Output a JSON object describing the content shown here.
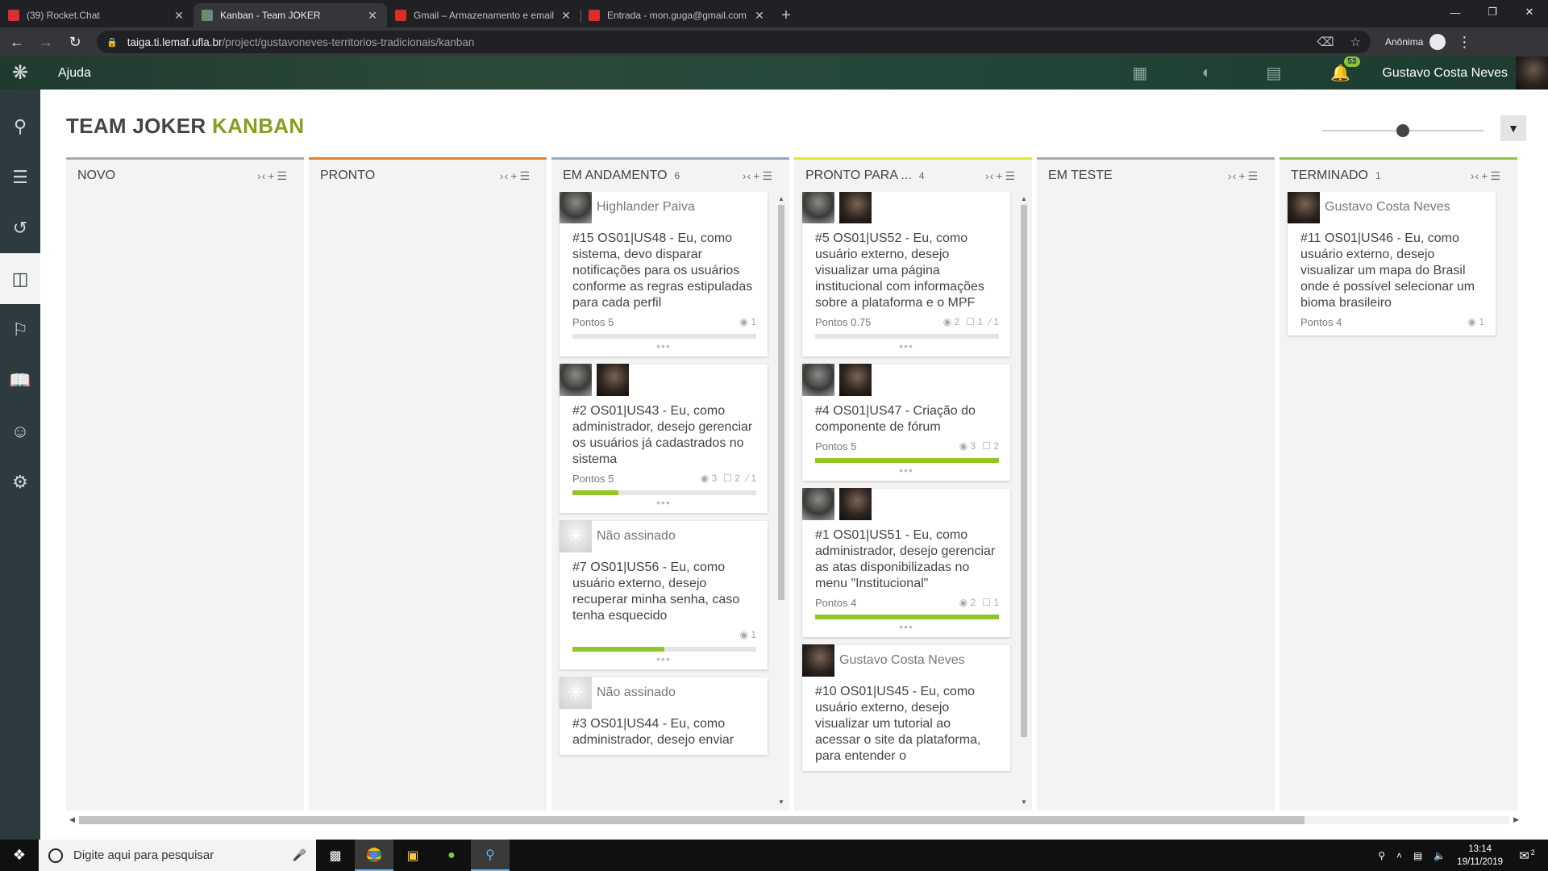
{
  "browser": {
    "tabs": [
      {
        "title": "(39) Rocket.Chat",
        "favicon": "rocket-chat-icon",
        "color": "#d92f2f",
        "active": false
      },
      {
        "title": "Kanban - Team JOKER",
        "favicon": "taiga-icon",
        "color": "#6a8c74",
        "active": true
      },
      {
        "title": "Gmail – Armazenamento e email",
        "favicon": "gmail-icon",
        "color": "#d93025",
        "active": false
      },
      {
        "title": "Entrada - mon.guga@gmail.com",
        "favicon": "gmail-icon",
        "color": "#d93025",
        "active": false
      }
    ],
    "url_host": "taiga.ti.lemaf.ufla.br",
    "url_path": "/project/gustavoneves-territorios-tradicionais/kanban",
    "profile_label": "Anônima"
  },
  "topbar": {
    "help_label": "Ajuda",
    "notifications_count": "53",
    "user_name": "Gustavo Costa Neves"
  },
  "page": {
    "title_main": "TEAM JOKER",
    "title_accent": "KANBAN",
    "accent_color": "#83a01f",
    "zoom_level": 0.5
  },
  "columns": [
    {
      "name": "NOVO",
      "count": "",
      "color": "#a9a9a9",
      "cards": []
    },
    {
      "name": "PRONTO",
      "count": "",
      "color": "#e8802c",
      "cards": []
    },
    {
      "name": "EM ANDAMENTO",
      "count": "6",
      "color": "#9aa9bc",
      "scroll": true,
      "cards": [
        {
          "avatars": [
            "a1"
          ],
          "assignee": "Highlander Paiva",
          "title": "#15 OS01|US48 - Eu, como sistema, devo disparar notificações para os usuários conforme as regras estipuladas para cada perfil",
          "points": "Pontos 5",
          "views": "1",
          "comments": "",
          "attachments": "",
          "progress": 0
        },
        {
          "avatars": [
            "a1",
            "a2"
          ],
          "assignee": "",
          "title": "#2 OS01|US43 - Eu, como administrador, desejo gerenciar os usuários já cadastrados no sistema",
          "points": "Pontos 5",
          "views": "3",
          "comments": "2",
          "attachments": "1",
          "progress": 0.25
        },
        {
          "avatars": [
            "gs"
          ],
          "assignee": "Não assinado",
          "title": "#7 OS01|US56 - Eu, como usuário externo, desejo recuperar minha senha, caso tenha esquecido",
          "points": "",
          "views": "1",
          "comments": "",
          "attachments": "",
          "progress": 0.5
        },
        {
          "avatars": [
            "gs"
          ],
          "assignee": "Não assinado",
          "title": "#3 OS01|US44 - Eu, como administrador, desejo enviar",
          "points": "",
          "views": "",
          "comments": "",
          "attachments": "",
          "progress": null
        }
      ]
    },
    {
      "name": "PRONTO PARA ...",
      "count": "4",
      "color": "#e8e43c",
      "scroll": true,
      "cards": [
        {
          "avatars": [
            "a1",
            "a2"
          ],
          "assignee": "",
          "title": "#5 OS01|US52 - Eu, como usuário externo, desejo visualizar uma página institucional com informações sobre a plataforma e o MPF",
          "points": "Pontos 0.75",
          "views": "2",
          "comments": "1",
          "attachments": "1",
          "progress": 0
        },
        {
          "avatars": [
            "a1",
            "a2"
          ],
          "assignee": "",
          "title": "#4 OS01|US47 - Criação do componente de fórum",
          "points": "Pontos 5",
          "views": "3",
          "comments": "2",
          "attachments": "",
          "progress": 1
        },
        {
          "avatars": [
            "a1",
            "a2"
          ],
          "assignee": "",
          "title": "#1 OS01|US51 - Eu, como administrador, desejo gerenciar as atas disponibilizadas no menu \"Institucional\"",
          "points": "Pontos 4",
          "views": "2",
          "comments": "1",
          "attachments": "",
          "progress": 1
        },
        {
          "avatars": [
            "a2"
          ],
          "assignee": "Gustavo Costa Neves",
          "title": "#10 OS01|US45 - Eu, como usuário externo, desejo visualizar um tutorial ao acessar o site da plataforma, para entender o",
          "points": "",
          "views": "",
          "comments": "",
          "attachments": "",
          "progress": null
        }
      ]
    },
    {
      "name": "EM TESTE",
      "count": "",
      "color": "#a9a9a9",
      "cards": []
    },
    {
      "name": "TERMINADO",
      "count": "1",
      "color": "#8cc43e",
      "cards": [
        {
          "avatars": [
            "a2"
          ],
          "assignee": "Gustavo Costa Neves",
          "title": "#11 OS01|US46 - Eu, como usuário externo, desejo visualizar um mapa do Brasil onde é possível selecionar um bioma brasileiro",
          "points": "Pontos 4",
          "views": "1",
          "comments": "",
          "attachments": "",
          "progress": null
        }
      ]
    }
  ],
  "taskbar": {
    "search_placeholder": "Digite aqui para pesquisar",
    "time": "13:14",
    "date": "19/11/2019",
    "notifications": "2"
  }
}
